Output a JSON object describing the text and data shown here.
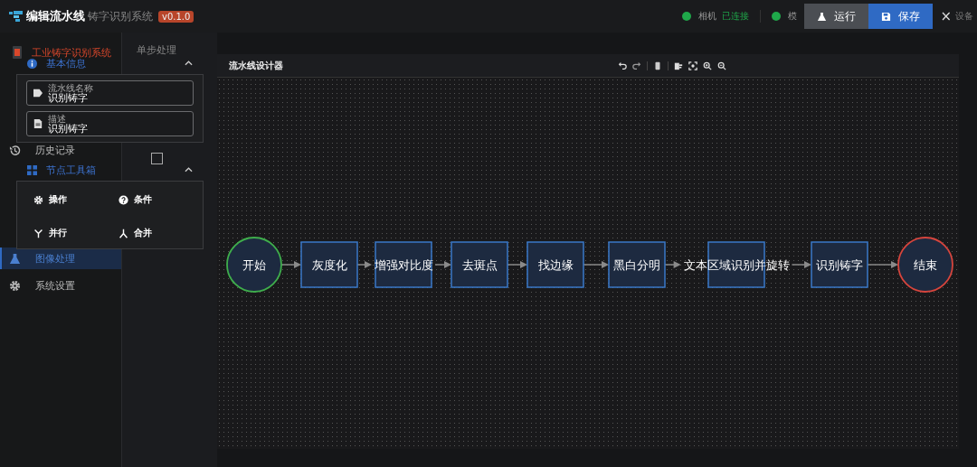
{
  "header": {
    "dialog_title": "编辑流水线",
    "app_title": "铸字识别系统",
    "version": "v0.1.0",
    "statuses": [
      {
        "name": "相机",
        "state": "已连接",
        "color": "#1fa84a"
      },
      {
        "name": "模",
        "color": "#1fa84a"
      }
    ],
    "buttons": [
      {
        "label": "运行",
        "kind": "run"
      },
      {
        "label": "保存",
        "kind": "save"
      }
    ],
    "close": "×",
    "trailing_text": "设备"
  },
  "sidebar": {
    "title": "工业铸字识别系统",
    "items": [
      {
        "label": "历史记录",
        "kind": "history",
        "selected": false
      },
      {
        "label": "图像处理",
        "kind": "flask",
        "selected": true
      },
      {
        "label": "系统设置",
        "kind": "gear",
        "selected": false
      }
    ]
  },
  "tabs": [
    {
      "label": "单步处理",
      "selected": false
    }
  ],
  "checkbox": {
    "checked": false
  },
  "basic_info": {
    "title": "基本信息",
    "expanded": true,
    "fields": [
      {
        "label": "流水线名称",
        "value": "识别铸字",
        "kind": "tag"
      },
      {
        "label": "描述",
        "value": "识别铸字",
        "kind": "doc"
      }
    ]
  },
  "toolbox": {
    "title": "节点工具箱",
    "expanded": true,
    "items": [
      {
        "label": "操作",
        "kind": "gear"
      },
      {
        "label": "条件",
        "kind": "question"
      },
      {
        "label": "并行",
        "kind": "split"
      },
      {
        "label": "合并",
        "kind": "merge"
      }
    ]
  },
  "designer": {
    "title": "流水线设计器",
    "nodes": [
      {
        "label": "开始",
        "kind": "start"
      },
      {
        "label": "灰度化",
        "kind": "process"
      },
      {
        "label": "增强对比度",
        "kind": "process"
      },
      {
        "label": "去斑点",
        "kind": "process"
      },
      {
        "label": "找边缘",
        "kind": "process"
      },
      {
        "label": "黑白分明",
        "kind": "process"
      },
      {
        "label": "文本区域识别并旋转",
        "kind": "process"
      },
      {
        "label": "识别铸字",
        "kind": "process"
      },
      {
        "label": "结束",
        "kind": "end"
      }
    ]
  }
}
